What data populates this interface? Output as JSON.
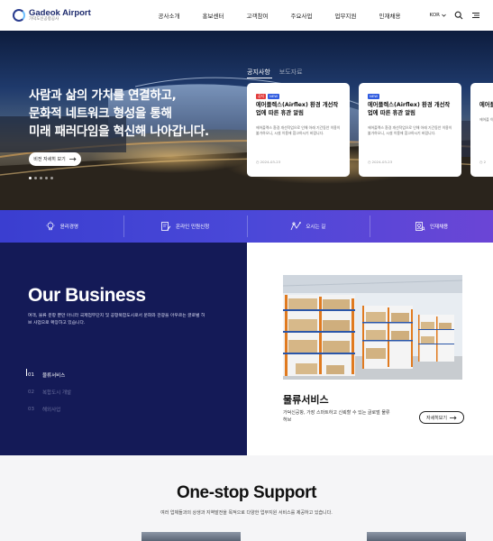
{
  "header": {
    "logo_name": "Gadeok Airport",
    "logo_sub": "가덕도신공항공사",
    "nav": [
      "공사소개",
      "홍보센터",
      "고객참여",
      "주요사업",
      "업무지원",
      "인재채용"
    ],
    "lang": "KOR"
  },
  "hero": {
    "title_lines": [
      "사람과 삶의 가치를 연결하고,",
      "문화적 네트워크 형성을 통해",
      "미래 패러다임을 혁신해 나아갑니다."
    ],
    "button_label": "비전 자세히 보기",
    "notice_tabs": [
      "공지사항",
      "보도자료"
    ],
    "cards": [
      {
        "badges": [
          "공지",
          "NEW"
        ],
        "title": "에어플렉스(Airflex) 환경 개선작업에 따른 휴관 알림",
        "body": "에어플렉스 환경 개선작업으로 인해 아래 기간동안 이용이 불가하오니, 시설 이용에 참고하시기 바랍니다.",
        "date": "2024-03-23"
      },
      {
        "badges": [
          "NEW"
        ],
        "title": "에어플렉스(Airflex) 환경 개선작업에 따른 휴관 알림",
        "body": "에어플렉스 환경 개선작업으로 인해 아래 기간동안 이용이 불가하오니, 시설 이용에 참고하시기 바랍니다.",
        "date": "2024-03-23"
      },
      {
        "badges": [],
        "title": "에어플",
        "body": "에어플 이용이 바랍니",
        "date": "2"
      }
    ]
  },
  "quick_links": [
    {
      "label": "윤리경영",
      "icon": "lightbulb-icon"
    },
    {
      "label": "온라인 민원신청",
      "icon": "document-edit-icon"
    },
    {
      "label": "오시는 길",
      "icon": "map-route-icon"
    },
    {
      "label": "인재채용",
      "icon": "person-search-icon"
    }
  ],
  "business": {
    "title": "Our Business",
    "description": "여객, 물류 운항 뿐만 아니라 국제업무단지 및 공항복합도시로서 문화와 관광을 아우르는 글로벌 허브 사업으로 확장하고 있습니다.",
    "items": [
      {
        "num": "01",
        "label": "물류서비스"
      },
      {
        "num": "02",
        "label": "복합도시 개발"
      },
      {
        "num": "03",
        "label": "해외사업"
      }
    ],
    "active_name": "물류서비스",
    "active_desc": "가덕신공항, 가장 스마트하고 신뢰할 수 있는 글로벌 물류 허브",
    "more_label": "자세히보기"
  },
  "support": {
    "title": "One-stop Support",
    "description": "여러 업체들과의 상생과 지역발전을 목적으로 다양한 업무지원 서비스를 제공하고 있습니다."
  },
  "colors": {
    "navy": "#141a57",
    "quick_gradient_start": "#3a3ed0",
    "quick_gradient_end": "#6b45d6",
    "badge_red": "#e23b3b",
    "badge_blue": "#2f5be0"
  }
}
